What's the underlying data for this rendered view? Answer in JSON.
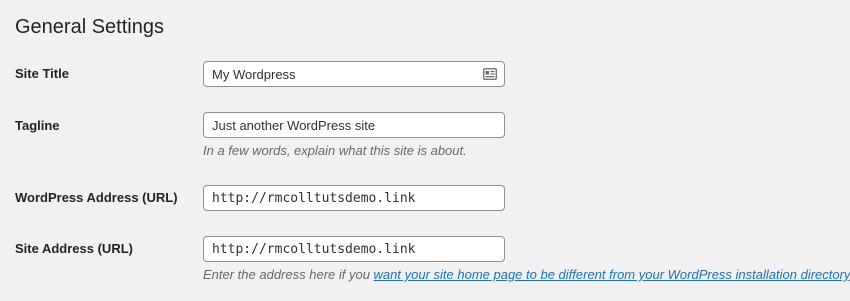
{
  "page": {
    "title": "General Settings"
  },
  "settings": {
    "site_title": {
      "label": "Site Title",
      "value": "My Wordpress",
      "icon": "contact-card-icon"
    },
    "tagline": {
      "label": "Tagline",
      "value": "Just another WordPress site",
      "description": "In a few words, explain what this site is about."
    },
    "wordpress_address": {
      "label": "WordPress Address (URL)",
      "value": "http://rmcolltutsdemo.link"
    },
    "site_address": {
      "label": "Site Address (URL)",
      "value": "http://rmcolltutsdemo.link",
      "description_prefix": "Enter the address here if you ",
      "description_link": "want your site home page to be different from your WordPress installation directory",
      "description_suffix": "."
    }
  },
  "colors": {
    "background": "#f1f1f1",
    "link": "#2271b1",
    "description_text": "#646970",
    "input_border": "#8c8f94"
  }
}
